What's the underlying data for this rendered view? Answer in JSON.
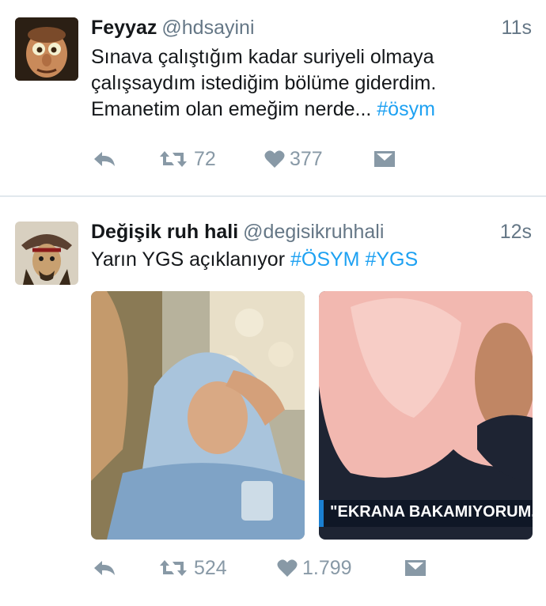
{
  "tweets": [
    {
      "name": "Feyyaz",
      "handle": "@hdsayini",
      "time": "11s",
      "text_lines": [
        "Sınava çalıştığım kadar suriyeli olmaya",
        "çalışsaydım istediğim bölüme giderdim."
      ],
      "text_line3": "Emanetim olan emeğim nerde... ",
      "hashtag1": "#ösym",
      "retweets": "72",
      "likes": "377",
      "icons": [
        "reply-icon",
        "retweet-icon",
        "heart-icon",
        "dm-icon"
      ]
    },
    {
      "name": "Değişik ruh hali",
      "handle": "@degisikruhhali",
      "time": "12s",
      "text": "Yarın YGS açıklanıyor ",
      "hashtag1": "#ÖSYM",
      "hashtag2": "#YGS",
      "banner_text": "\"EKRANA BAKAMIYORUM, M",
      "retweets": "524",
      "likes": "1.799",
      "icons": [
        "reply-icon",
        "retweet-icon",
        "heart-icon",
        "dm-icon"
      ]
    }
  ],
  "colors": {
    "link": "#1da1f2",
    "muted": "#657786",
    "icon": "#8899a6",
    "divider": "#e1e8ed"
  }
}
